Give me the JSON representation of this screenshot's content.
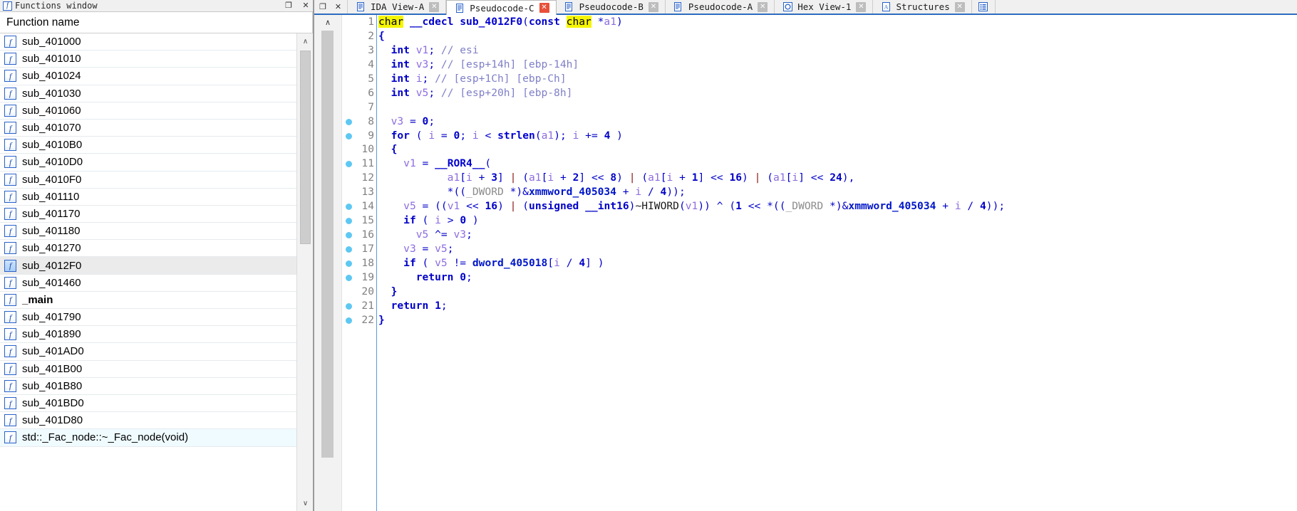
{
  "functions_window": {
    "title": "Functions window",
    "title_icon": "function-icon",
    "minimize_label": "❐",
    "close_label": "✕",
    "column_header": "Function name",
    "scroll_up": "∧",
    "scroll_down": "∨",
    "items": [
      {
        "name": "sub_401000",
        "bold": false,
        "selected": false
      },
      {
        "name": "sub_401010",
        "bold": false,
        "selected": false
      },
      {
        "name": "sub_401024",
        "bold": false,
        "selected": false
      },
      {
        "name": "sub_401030",
        "bold": false,
        "selected": false
      },
      {
        "name": "sub_401060",
        "bold": false,
        "selected": false
      },
      {
        "name": "sub_401070",
        "bold": false,
        "selected": false
      },
      {
        "name": "sub_4010B0",
        "bold": false,
        "selected": false
      },
      {
        "name": "sub_4010D0",
        "bold": false,
        "selected": false
      },
      {
        "name": "sub_4010F0",
        "bold": false,
        "selected": false
      },
      {
        "name": "sub_401110",
        "bold": false,
        "selected": false
      },
      {
        "name": "sub_401170",
        "bold": false,
        "selected": false
      },
      {
        "name": "sub_401180",
        "bold": false,
        "selected": false
      },
      {
        "name": "sub_401270",
        "bold": false,
        "selected": false
      },
      {
        "name": "sub_4012F0",
        "bold": false,
        "selected": true
      },
      {
        "name": "sub_401460",
        "bold": false,
        "selected": false
      },
      {
        "name": "_main",
        "bold": true,
        "selected": false
      },
      {
        "name": "sub_401790",
        "bold": false,
        "selected": false
      },
      {
        "name": "sub_401890",
        "bold": false,
        "selected": false
      },
      {
        "name": "sub_401AD0",
        "bold": false,
        "selected": false
      },
      {
        "name": "sub_401B00",
        "bold": false,
        "selected": false
      },
      {
        "name": "sub_401B80",
        "bold": false,
        "selected": false
      },
      {
        "name": "sub_401BD0",
        "bold": false,
        "selected": false
      },
      {
        "name": "sub_401D80",
        "bold": false,
        "selected": false
      },
      {
        "name": "std::_Fac_node::~_Fac_node(void)",
        "bold": false,
        "selected": false
      }
    ]
  },
  "window_controls": {
    "restore": "❐",
    "close": "✕"
  },
  "tabs": [
    {
      "label": "IDA View-A",
      "icon": "document-icon",
      "active": false,
      "close": "✕",
      "close_red": false
    },
    {
      "label": "Pseudocode-C",
      "icon": "document-icon",
      "active": true,
      "close": "✕",
      "close_red": true
    },
    {
      "label": "Pseudocode-B",
      "icon": "document-icon",
      "active": false,
      "close": "✕",
      "close_red": false
    },
    {
      "label": "Pseudocode-A",
      "icon": "document-icon",
      "active": false,
      "close": "✕",
      "close_red": false
    },
    {
      "label": "Hex View-1",
      "icon": "hex-icon",
      "active": false,
      "close": "✕",
      "close_red": false
    },
    {
      "label": "Structures",
      "icon": "structures-icon",
      "active": false,
      "close": "✕",
      "close_red": false
    }
  ],
  "tab_extra_icon": "enums-icon",
  "editor": {
    "scroll_up_arrow": "∧",
    "line_count": 22,
    "breakpoint_lines": [
      8,
      9,
      11,
      14,
      15,
      16,
      17,
      18,
      19,
      21,
      22
    ],
    "highlighted_token": "char",
    "lines": [
      {
        "n": 1,
        "text": "char __cdecl sub_4012F0(const char *a1)"
      },
      {
        "n": 2,
        "text": "{"
      },
      {
        "n": 3,
        "text": "  int v1; // esi"
      },
      {
        "n": 4,
        "text": "  int v3; // [esp+14h] [ebp-14h]"
      },
      {
        "n": 5,
        "text": "  int i; // [esp+1Ch] [ebp-Ch]"
      },
      {
        "n": 6,
        "text": "  int v5; // [esp+20h] [ebp-8h]"
      },
      {
        "n": 7,
        "text": ""
      },
      {
        "n": 8,
        "text": "  v3 = 0;"
      },
      {
        "n": 9,
        "text": "  for ( i = 0; i < strlen(a1); i += 4 )"
      },
      {
        "n": 10,
        "text": "  {"
      },
      {
        "n": 11,
        "text": "    v1 = __ROR4__("
      },
      {
        "n": 12,
        "text": "           a1[i + 3] | (a1[i + 2] << 8) | (a1[i + 1] << 16) | (a1[i] << 24),"
      },
      {
        "n": 13,
        "text": "           *((_DWORD *)&xmmword_405034 + i / 4));"
      },
      {
        "n": 14,
        "text": "    v5 = ((v1 << 16) | (unsigned __int16)~HIWORD(v1)) ^ (1 << *((_DWORD *)&xmmword_405034 + i / 4));"
      },
      {
        "n": 15,
        "text": "    if ( i > 0 )"
      },
      {
        "n": 16,
        "text": "      v5 ^= v3;"
      },
      {
        "n": 17,
        "text": "    v3 = v5;"
      },
      {
        "n": 18,
        "text": "    if ( v5 != dword_405018[i / 4] )"
      },
      {
        "n": 19,
        "text": "      return 0;"
      },
      {
        "n": 20,
        "text": "  }"
      },
      {
        "n": 21,
        "text": "  return 1;"
      },
      {
        "n": 22,
        "text": "}"
      }
    ]
  },
  "colors": {
    "keyword": "#0000c8",
    "variable": "#8c6ce0",
    "data_ref": "#0016c8",
    "comment": "#7f7fc8",
    "type_gray": "#8c8c8c",
    "highlight_bg": "#f5f500",
    "breakpoint_dot": "#5ec8f2",
    "tab_active_underline": "#2f6cbf",
    "selection_bg": "#ebebeb"
  }
}
